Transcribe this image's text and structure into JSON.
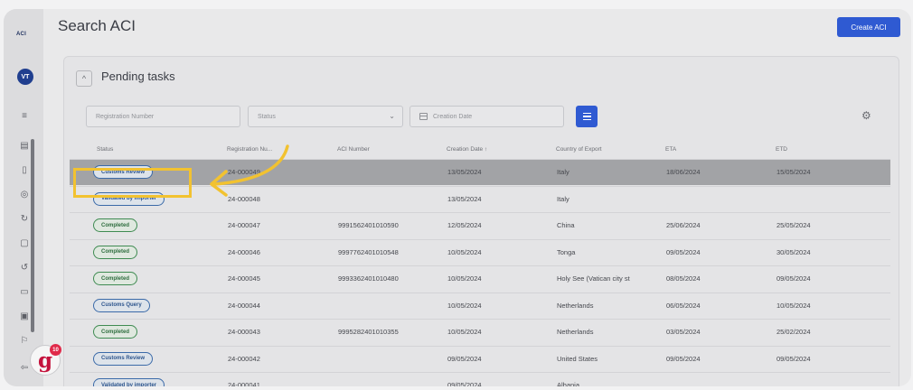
{
  "sidebar": {
    "logo": "ACI",
    "avatar": "VT",
    "icons": [
      "menu-icon",
      "document-list-icon",
      "document-icon",
      "globe-icon",
      "refresh-icon",
      "file-icon",
      "sync-icon",
      "chat-icon",
      "monitor-icon",
      "flag-icon",
      "logout-icon"
    ]
  },
  "header": {
    "title": "Search ACI",
    "create_label": "Create ACI"
  },
  "section": {
    "collapse_symbol": "^",
    "title": "Pending tasks"
  },
  "filters": {
    "registration_placeholder": "Registration Number",
    "status_placeholder": "Status",
    "creation_date_placeholder": "Creation Date"
  },
  "table": {
    "headers": {
      "status": "Status",
      "registration": "Registration Nu...",
      "aci": "ACI Number",
      "creation": "Creation Date ↑",
      "country": "Country of Export",
      "eta": "ETA",
      "etd": "ETD"
    },
    "rows": [
      {
        "status": "Customs Review",
        "reg": "24-000049",
        "aci": "",
        "creation": "13/05/2024",
        "country": "Italy",
        "eta": "18/06/2024",
        "etd": "15/05/2024"
      },
      {
        "status": "Validated by importer",
        "reg": "24-000048",
        "aci": "",
        "creation": "13/05/2024",
        "country": "Italy",
        "eta": "",
        "etd": ""
      },
      {
        "status": "Completed",
        "reg": "24-000047",
        "aci": "9991562401010590",
        "creation": "12/05/2024",
        "country": "China",
        "eta": "25/06/2024",
        "etd": "25/05/2024"
      },
      {
        "status": "Completed",
        "reg": "24-000046",
        "aci": "9997762401010548",
        "creation": "10/05/2024",
        "country": "Tonga",
        "eta": "09/05/2024",
        "etd": "30/05/2024"
      },
      {
        "status": "Completed",
        "reg": "24-000045",
        "aci": "9993362401010480",
        "creation": "10/05/2024",
        "country": "Holy See (Vatican city st",
        "eta": "08/05/2024",
        "etd": "09/05/2024"
      },
      {
        "status": "Customs Query",
        "reg": "24-000044",
        "aci": "",
        "creation": "10/05/2024",
        "country": "Netherlands",
        "eta": "06/05/2024",
        "etd": "10/05/2024"
      },
      {
        "status": "Completed",
        "reg": "24-000043",
        "aci": "9995282401010355",
        "creation": "10/05/2024",
        "country": "Netherlands",
        "eta": "03/05/2024",
        "etd": "25/02/2024"
      },
      {
        "status": "Customs Review",
        "reg": "24-000042",
        "aci": "",
        "creation": "09/05/2024",
        "country": "United States",
        "eta": "09/05/2024",
        "etd": "09/05/2024"
      },
      {
        "status": "Validated by importer",
        "reg": "24-000041",
        "aci": "",
        "creation": "09/05/2024",
        "country": "Albania",
        "eta": "",
        "etd": ""
      }
    ]
  },
  "badge_colors": {
    "Completed": "green",
    "Customs Review": "blue",
    "Validated by importer": "blue",
    "Customs Query": "blue"
  },
  "guide_badge": {
    "letter": "g",
    "dot": "10"
  },
  "colors": {
    "accent": "#2f5ad2",
    "highlight": "#f2c230",
    "completed": "#3f8b52",
    "review": "#3b6aa8"
  }
}
